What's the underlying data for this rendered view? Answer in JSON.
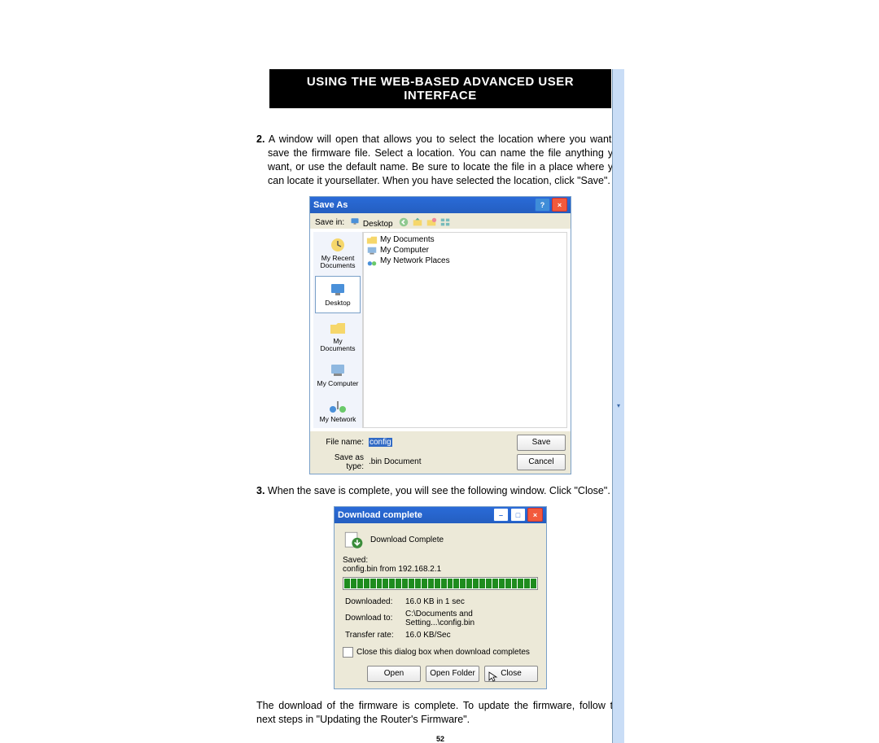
{
  "heading": "USING THE WEB-BASED ADVANCED USER INTERFACE",
  "step2": {
    "num": "2.",
    "text": "A window will open that allows you to select the location where you want to save the firmware file. Select a location. You can name the file anything you want, or use the default name. Be sure to locate the file in a place where you can locate it yoursellater. When you have selected the location, click \"Save\"."
  },
  "saveas": {
    "title": "Save As",
    "savein_label": "Save in:",
    "savein_value": "Desktop",
    "places": [
      {
        "label": "My Recent Documents",
        "icon": "recent"
      },
      {
        "label": "Desktop",
        "icon": "desktop",
        "selected": true
      },
      {
        "label": "My Documents",
        "icon": "mydocs"
      },
      {
        "label": "My Computer",
        "icon": "mycomp"
      },
      {
        "label": "My Network",
        "icon": "mynet"
      }
    ],
    "file_items": [
      {
        "label": "My Documents",
        "icon": "folder"
      },
      {
        "label": "My Computer",
        "icon": "computer"
      },
      {
        "label": "My Network Places",
        "icon": "network"
      }
    ],
    "filename_label": "File name:",
    "filename_value": "config",
    "saveastype_label": "Save as type:",
    "saveastype_value": ".bin Document",
    "save_btn": "Save",
    "cancel_btn": "Cancel"
  },
  "step3": {
    "num": "3.",
    "text": "When the save is complete, you will see the following window. Click \"Close\"."
  },
  "dl": {
    "title": "Download complete",
    "heading": "Download Complete",
    "saved_label": "Saved:",
    "saved_value": "config.bin from 192.168.2.1",
    "rows": [
      {
        "k": "Downloaded:",
        "v": "16.0 KB in 1 sec"
      },
      {
        "k": "Download to:",
        "v": "C:\\Documents and Setting...\\config.bin"
      },
      {
        "k": "Transfer rate:",
        "v": "16.0 KB/Sec"
      }
    ],
    "checkbox": "Close this dialog box when download completes",
    "open_btn": "Open",
    "openfolder_btn": "Open Folder",
    "close_btn": "Close"
  },
  "footer_text": "The download of the firmware is complete. To update the firmware, follow the next steps in \"Updating the Router's Firmware\".",
  "page_num": "52"
}
